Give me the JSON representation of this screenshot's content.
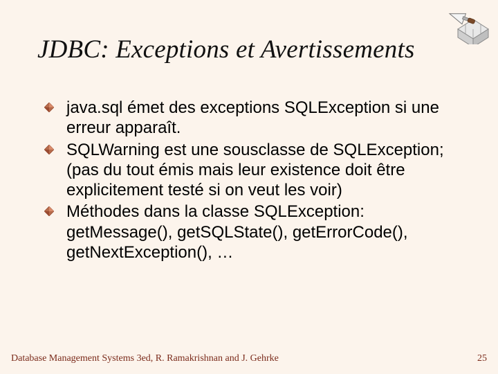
{
  "title": "JDBC: Exceptions et Avertissements",
  "bullets": [
    "java.sql émet des exceptions SQLException si une erreur apparaît.",
    "SQLWarning est une sousclasse de SQLException; (pas du tout émis mais leur existence doit être explicitement testé si on veut les voir)",
    "Méthodes dans la classe SQLException: getMessage(), getSQLState(), getErrorCode(), getNextException(), …"
  ],
  "footer": {
    "left": "Database Management Systems 3ed, R. Ramakrishnan and J. Gehrke",
    "page": "25"
  }
}
